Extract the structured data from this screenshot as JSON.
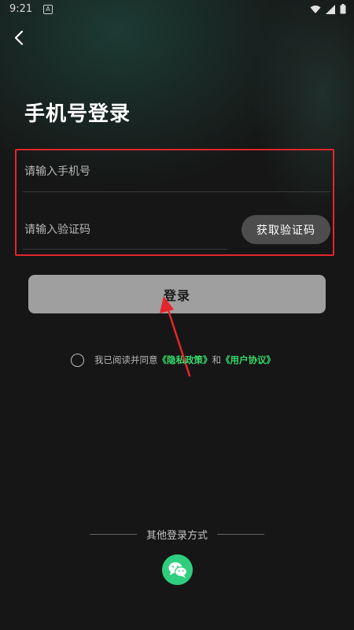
{
  "status_bar": {
    "time": "9:21",
    "notification_icon_letter": "A",
    "icons": [
      "wifi-icon",
      "signal-icon",
      "battery-icon"
    ]
  },
  "header": {
    "back_icon": "chevron-left-icon",
    "title": "手机号登录"
  },
  "form": {
    "phone_placeholder": "请输入手机号",
    "code_placeholder": "请输入验证码",
    "get_code_label": "获取验证码",
    "login_label": "登录"
  },
  "agreement": {
    "prefix": "我已阅读并同意",
    "privacy_link": "《隐私政策》",
    "and": "和",
    "user_link": "《用户协议》"
  },
  "other_login": {
    "label": "其他登录方式",
    "wechat_icon": "wechat-icon"
  },
  "colors": {
    "accent_green": "#35d86a",
    "wechat_green": "#2fce7e",
    "annotation_red": "#e3262c",
    "background": "#161616"
  }
}
